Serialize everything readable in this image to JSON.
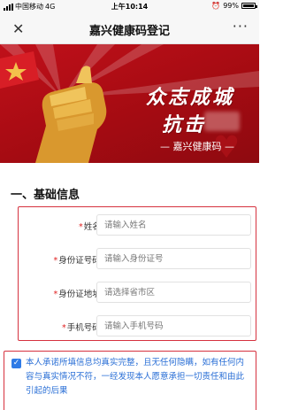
{
  "status_bar": {
    "carrier": "中国移动",
    "network": "4G",
    "time": "上午10:14",
    "battery": "99%",
    "battery_level": 0.99
  },
  "nav": {
    "close_icon": "close-icon",
    "title": "嘉兴健康码登记",
    "more_label": "···"
  },
  "banner": {
    "slogan_line1": "众志成城",
    "slogan_line2": "抗击",
    "subtitle": "— 嘉兴健康码 —",
    "colors": {
      "primary": "#c0101a",
      "fist": "#e8b24a",
      "star": "#f3c14c"
    }
  },
  "section": {
    "title": "一、基础信息"
  },
  "form": {
    "required_mark": "*",
    "fields": [
      {
        "label": "姓名:",
        "placeholder": "请输入姓名"
      },
      {
        "label": "身份证号码:",
        "placeholder": "请输入身份证号"
      },
      {
        "label": "身份证地址:",
        "placeholder": "请选择省市区"
      },
      {
        "label": "手机号码:",
        "placeholder": "请输入手机号码"
      }
    ]
  },
  "agreement": {
    "checked": true,
    "check_mark": "✓",
    "text": "本人承诺所填信息均真实完整，且无任何隐瞒，如有任何内容与真实情况不符，一经发现本人愿意承担一切责任和由此引起的后果"
  },
  "colors": {
    "highlight_border": "#d6323f",
    "required": "#e02020",
    "link_blue": "#2a6fd6",
    "checkbox": "#2f7be6"
  }
}
